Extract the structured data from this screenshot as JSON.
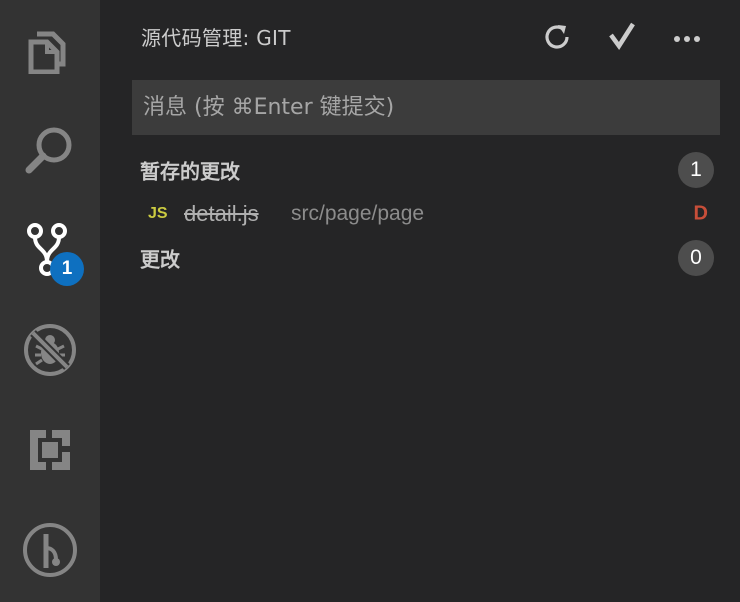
{
  "activity_bar": {
    "items": [
      {
        "name": "explorer",
        "icon": "files-icon",
        "active": false
      },
      {
        "name": "search",
        "icon": "search-icon",
        "active": false
      },
      {
        "name": "source-control",
        "icon": "source-control-icon",
        "active": true,
        "badge": "1"
      },
      {
        "name": "debug",
        "icon": "debug-disabled-icon",
        "active": false
      },
      {
        "name": "extensions",
        "icon": "extensions-icon",
        "active": false
      },
      {
        "name": "git-graph",
        "icon": "git-graph-icon",
        "active": false
      }
    ],
    "colors": {
      "active": "#ffffff",
      "inactive": "#858585",
      "badge": "#0e70c0"
    }
  },
  "sidebar": {
    "title": "源代码管理: GIT",
    "actions": [
      {
        "name": "refresh",
        "icon": "refresh-icon"
      },
      {
        "name": "commit",
        "icon": "check-icon"
      },
      {
        "name": "more",
        "icon": "ellipsis-icon"
      }
    ],
    "commit_input": {
      "value": "",
      "placeholder": "消息 (按 ⌘Enter 键提交)"
    },
    "staged": {
      "label": "暂存的更改",
      "count": "1",
      "files": [
        {
          "icon_text": "JS",
          "name": "detail.js",
          "path": "src/page/page",
          "status": "D"
        }
      ]
    },
    "changes": {
      "label": "更改",
      "count": "0"
    }
  },
  "colors": {
    "background": "#252526",
    "activity_bar": "#333333",
    "input_background": "#3c3c3c",
    "deleted_status": "#c74e39",
    "js_icon": "#cbcb41",
    "count_badge": "#4d4d4d"
  }
}
